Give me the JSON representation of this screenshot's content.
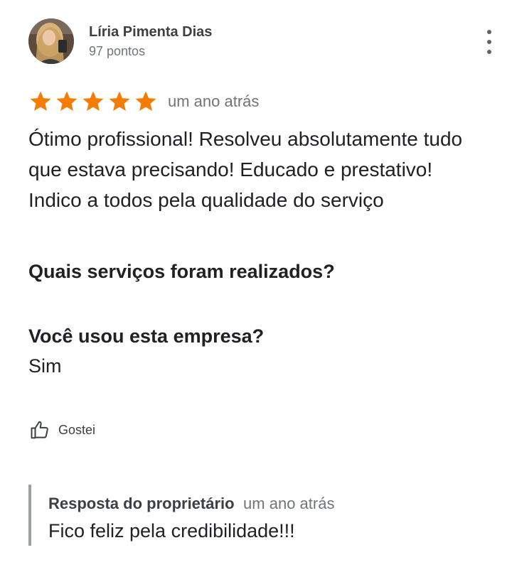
{
  "author": {
    "name": "Líria Pimenta Dias",
    "points": "97 pontos"
  },
  "menu": {
    "icon": "more-vert-icon"
  },
  "rating": {
    "stars": 5,
    "max": 5,
    "star_color": "#f57c00",
    "time": "um ano atrás"
  },
  "review": {
    "text": "Ótimo profissional! Resolveu absolutamente tudo que estava precisando! Educado e prestativo! Indico a todos pela qualidade do serviço"
  },
  "questions": {
    "services_question": "Quais serviços foram realizados?",
    "used_question": "Você usou esta empresa?",
    "used_answer": "Sim"
  },
  "actions": {
    "like_label": "Gostei",
    "like_icon": "thumb-up-icon"
  },
  "owner_reply": {
    "title": "Resposta do proprietário",
    "time": "um ano atrás",
    "text": "Fico feliz pela credibilidade!!!"
  }
}
